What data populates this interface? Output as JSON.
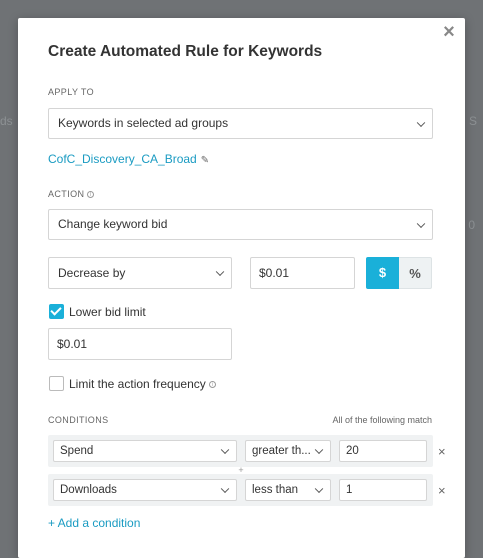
{
  "modal": {
    "title": "Create Automated Rule for Keywords",
    "close_icon": "×"
  },
  "apply_to": {
    "label": "APPLY TO",
    "selected": "Keywords in selected ad groups",
    "adgroup_link": "CofC_Discovery_CA_Broad",
    "edit_icon": "✎"
  },
  "action": {
    "label": "ACTION",
    "info_icon": "i",
    "selected": "Change keyword bid",
    "direction": "Decrease by",
    "amount": "$0.01",
    "unit_dollar": "$",
    "unit_percent": "%",
    "unit_selected": "$"
  },
  "lower_bid_limit": {
    "label": "Lower bid limit",
    "checked": true,
    "value": "$0.01"
  },
  "frequency": {
    "label": "Limit the action frequency",
    "checked": false,
    "info_icon": "i"
  },
  "conditions": {
    "label": "CONDITIONS",
    "match": "All of the following match",
    "rows": [
      {
        "metric": "Spend",
        "operator": "greater th...",
        "value": "20",
        "remove": "×"
      },
      {
        "metric": "Downloads",
        "operator": "less than",
        "value": "1",
        "remove": "×"
      }
    ],
    "separator": "+",
    "add_label": "+ Add a condition"
  },
  "backdrop": {
    "left": "ds",
    "right": "S",
    "right2": "0"
  },
  "colors": {
    "accent": "#1ab0d9",
    "link": "#1a9bc2",
    "overlay": "#6f7275"
  }
}
